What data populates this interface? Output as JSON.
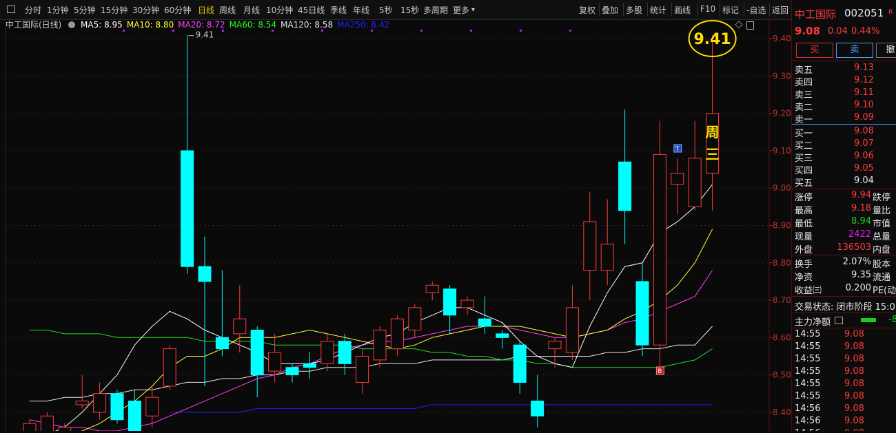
{
  "toolbar": {
    "periods": [
      "分时",
      "1分钟",
      "5分钟",
      "15分钟",
      "30分钟",
      "60分钟",
      "日线",
      "周线",
      "月线",
      "10分钟",
      "45日线",
      "季线",
      "年线",
      "5秒",
      "15秒",
      "多周期",
      "更多"
    ],
    "active_period": "日线",
    "right_items": [
      "复权",
      "叠加",
      "多股",
      "统计",
      "画线",
      "F10",
      "标记",
      "-自选",
      "返回"
    ]
  },
  "chart_header": {
    "name": "中工国际(日线)",
    "ma": [
      {
        "label": "MA5: 8.95",
        "color": "#ffffff"
      },
      {
        "label": "MA10: 8.80",
        "color": "#ffff40"
      },
      {
        "label": "MA20: 8.72",
        "color": "#ff40ff"
      },
      {
        "label": "MA60: 8.54",
        "color": "#20ff20"
      },
      {
        "label": "MA120: 8.58",
        "color": "#e8e8e8"
      },
      {
        "label": "MA250: 8.42",
        "color": "#2020ff"
      }
    ]
  },
  "annotations": {
    "high_label": "9.41",
    "circled_value": "9.41",
    "week_char_1": "周",
    "week_char_2": "三",
    "t_marker": "T",
    "b_marker": "B"
  },
  "y_axis": {
    "min": 8.35,
    "max": 9.45,
    "ticks": [
      "9.40",
      "9.30",
      "9.20",
      "9.10",
      "9.00",
      "8.90",
      "8.80",
      "8.70",
      "8.60",
      "8.50",
      "8.40"
    ]
  },
  "colors": {
    "up": "#ff3b3b",
    "down": "#00ffff",
    "ma5": "#ffffff",
    "ma10": "#ffff40",
    "ma20": "#ff40ff",
    "ma60": "#20dd20",
    "ma120": "#e8e8e8",
    "ma250": "#2020ff",
    "highlight": "#ffe000"
  },
  "chart_data": {
    "type": "candlestick",
    "candles": [
      {
        "o": 8.31,
        "c": 8.37,
        "h": 8.38,
        "l": 8.3
      },
      {
        "o": 8.33,
        "c": 8.39,
        "h": 8.4,
        "l": 8.31
      },
      {
        "o": 8.32,
        "c": 8.36,
        "h": 8.37,
        "l": 8.3
      },
      {
        "o": 8.42,
        "c": 8.43,
        "h": 8.5,
        "l": 8.41
      },
      {
        "o": 8.4,
        "c": 8.45,
        "h": 8.48,
        "l": 8.38
      },
      {
        "o": 8.45,
        "c": 8.38,
        "h": 8.46,
        "l": 8.37
      },
      {
        "o": 8.43,
        "c": 8.34,
        "h": 8.46,
        "l": 8.33
      },
      {
        "o": 8.39,
        "c": 8.44,
        "h": 8.47,
        "l": 8.36
      },
      {
        "o": 8.47,
        "c": 8.57,
        "h": 8.58,
        "l": 8.46
      },
      {
        "o": 9.1,
        "c": 8.79,
        "h": 9.41,
        "l": 8.77
      },
      {
        "o": 8.79,
        "c": 8.75,
        "h": 8.87,
        "l": 8.47
      },
      {
        "o": 8.6,
        "c": 8.57,
        "h": 8.78,
        "l": 8.55
      },
      {
        "o": 8.61,
        "c": 8.65,
        "h": 8.74,
        "l": 8.56
      },
      {
        "o": 8.62,
        "c": 8.5,
        "h": 8.63,
        "l": 8.44
      },
      {
        "o": 8.51,
        "c": 8.56,
        "h": 8.61,
        "l": 8.48
      },
      {
        "o": 8.52,
        "c": 8.5,
        "h": 8.53,
        "l": 8.48
      },
      {
        "o": 8.53,
        "c": 8.52,
        "h": 8.56,
        "l": 8.49
      },
      {
        "o": 8.53,
        "c": 8.59,
        "h": 8.61,
        "l": 8.51
      },
      {
        "o": 8.59,
        "c": 8.53,
        "h": 8.61,
        "l": 8.5
      },
      {
        "o": 8.48,
        "c": 8.55,
        "h": 8.57,
        "l": 8.45
      },
      {
        "o": 8.54,
        "c": 8.62,
        "h": 8.63,
        "l": 8.52
      },
      {
        "o": 8.57,
        "c": 8.65,
        "h": 8.66,
        "l": 8.55
      },
      {
        "o": 8.62,
        "c": 8.68,
        "h": 8.69,
        "l": 8.6
      },
      {
        "o": 8.72,
        "c": 8.74,
        "h": 8.75,
        "l": 8.7
      },
      {
        "o": 8.73,
        "c": 8.66,
        "h": 8.74,
        "l": 8.61
      },
      {
        "o": 8.68,
        "c": 8.7,
        "h": 8.71,
        "l": 8.66
      },
      {
        "o": 8.65,
        "c": 8.63,
        "h": 8.71,
        "l": 8.61
      },
      {
        "o": 8.61,
        "c": 8.6,
        "h": 8.62,
        "l": 8.57
      },
      {
        "o": 8.58,
        "c": 8.48,
        "h": 8.59,
        "l": 8.45
      },
      {
        "o": 8.43,
        "c": 8.39,
        "h": 8.5,
        "l": 8.36
      },
      {
        "o": 8.57,
        "c": 8.59,
        "h": 8.6,
        "l": 8.52
      },
      {
        "o": 8.56,
        "c": 8.68,
        "h": 8.74,
        "l": 8.54
      },
      {
        "o": 8.78,
        "c": 8.91,
        "h": 8.99,
        "l": 8.7
      },
      {
        "o": 8.78,
        "c": 8.85,
        "h": 8.97,
        "l": 8.74
      },
      {
        "o": 9.07,
        "c": 8.94,
        "h": 9.21,
        "l": 8.85
      },
      {
        "o": 8.75,
        "c": 8.58,
        "h": 8.8,
        "l": 8.55
      },
      {
        "o": 8.58,
        "c": 9.09,
        "h": 9.18,
        "l": 8.5
      },
      {
        "o": 9.01,
        "c": 9.04,
        "h": 9.08,
        "l": 8.93
      },
      {
        "o": 8.95,
        "c": 9.08,
        "h": 9.18,
        "l": 8.94
      },
      {
        "o": 9.04,
        "c": 9.2,
        "h": 9.41,
        "l": 8.94
      }
    ],
    "ma5": [
      8.32,
      8.34,
      8.36,
      8.4,
      8.45,
      8.5,
      8.58,
      8.63,
      8.67,
      8.65,
      8.62,
      8.6,
      8.58,
      8.56,
      8.53,
      8.53,
      8.53,
      8.54,
      8.56,
      8.58,
      8.6,
      8.61,
      8.64,
      8.66,
      8.68,
      8.68,
      8.66,
      8.64,
      8.59,
      8.55,
      8.53,
      8.52,
      8.63,
      8.72,
      8.79,
      8.8,
      8.88,
      8.91,
      8.95,
      9.01
    ],
    "ma10": [
      8.3,
      8.32,
      8.33,
      8.35,
      8.37,
      8.4,
      8.43,
      8.47,
      8.52,
      8.55,
      8.55,
      8.57,
      8.6,
      8.6,
      8.6,
      8.61,
      8.62,
      8.61,
      8.6,
      8.59,
      8.58,
      8.57,
      8.58,
      8.6,
      8.61,
      8.62,
      8.63,
      8.63,
      8.63,
      8.62,
      8.61,
      8.6,
      8.61,
      8.62,
      8.65,
      8.67,
      8.7,
      8.74,
      8.8,
      8.89
    ],
    "ma20": [
      8.38,
      8.37,
      8.36,
      8.36,
      8.35,
      8.35,
      8.36,
      8.37,
      8.39,
      8.41,
      8.43,
      8.45,
      8.47,
      8.49,
      8.5,
      8.52,
      8.53,
      8.55,
      8.57,
      8.58,
      8.59,
      8.59,
      8.6,
      8.61,
      8.62,
      8.63,
      8.63,
      8.63,
      8.62,
      8.61,
      8.6,
      8.6,
      8.61,
      8.62,
      8.64,
      8.65,
      8.67,
      8.69,
      8.71,
      8.78
    ],
    "ma60": [
      8.62,
      8.62,
      8.61,
      8.61,
      8.61,
      8.6,
      8.6,
      8.6,
      8.6,
      8.6,
      8.59,
      8.59,
      8.59,
      8.59,
      8.58,
      8.58,
      8.58,
      8.58,
      8.58,
      8.57,
      8.57,
      8.57,
      8.57,
      8.56,
      8.56,
      8.55,
      8.55,
      8.54,
      8.54,
      8.53,
      8.53,
      8.52,
      8.52,
      8.52,
      8.52,
      8.52,
      8.52,
      8.53,
      8.54,
      8.57
    ],
    "ma120": [
      8.43,
      8.43,
      8.44,
      8.44,
      8.45,
      8.45,
      8.46,
      8.46,
      8.47,
      8.48,
      8.48,
      8.49,
      8.49,
      8.5,
      8.5,
      8.51,
      8.51,
      8.52,
      8.52,
      8.52,
      8.53,
      8.53,
      8.53,
      8.54,
      8.54,
      8.54,
      8.54,
      8.54,
      8.55,
      8.55,
      8.55,
      8.55,
      8.55,
      8.56,
      8.56,
      8.57,
      8.57,
      8.58,
      8.58,
      8.63
    ],
    "ma250": [
      null,
      null,
      null,
      null,
      null,
      null,
      null,
      null,
      8.4,
      8.4,
      8.4,
      8.4,
      8.4,
      8.41,
      8.41,
      8.41,
      8.41,
      8.41,
      8.41,
      8.41,
      8.41,
      8.41,
      8.41,
      8.42,
      8.42,
      8.42,
      8.42,
      8.42,
      8.42,
      8.42,
      8.42,
      8.42,
      8.42,
      8.42,
      8.42,
      8.42,
      8.42,
      8.42,
      8.42,
      8.42
    ]
  },
  "quote": {
    "name": "中工国际",
    "code": "002051",
    "badge": "R",
    "price": "9.08",
    "change": "0.04",
    "change_pct": "0.44%",
    "buy_label": "买",
    "sell_label": "卖",
    "cancel_label": "撤",
    "asks": [
      {
        "label": "卖五",
        "price": "9.13"
      },
      {
        "label": "卖四",
        "price": "9.12"
      },
      {
        "label": "卖三",
        "price": "9.11"
      },
      {
        "label": "卖二",
        "price": "9.10"
      },
      {
        "label": "卖一",
        "price": "9.09"
      }
    ],
    "bids": [
      {
        "label": "买一",
        "price": "9.08"
      },
      {
        "label": "买二",
        "price": "9.07"
      },
      {
        "label": "买三",
        "price": "9.06"
      },
      {
        "label": "买四",
        "price": "9.05"
      },
      {
        "label": "买五",
        "price": "9.04"
      }
    ],
    "stats": [
      {
        "label": "涨停",
        "value": "9.94",
        "label2": "跌停",
        "color": "red"
      },
      {
        "label": "最高",
        "value": "9.18",
        "label2": "量比",
        "color": "red"
      },
      {
        "label": "最低",
        "value": "8.94",
        "label2": "市值",
        "color": "green"
      },
      {
        "label": "现量",
        "value": "2422",
        "label2": "总量",
        "color": "mag"
      },
      {
        "label": "外盘",
        "value": "136503",
        "label2": "内盘",
        "color": "red"
      }
    ],
    "stats2": [
      {
        "label": "换手",
        "value": "2.07%",
        "label2": "股本"
      },
      {
        "label": "净资",
        "value": "9.35",
        "label2": "流通"
      },
      {
        "label": "收益㈢",
        "value": "0.200",
        "label2": "PE(动"
      }
    ],
    "trade_status": "交易状态: 闭市阶段 15:0",
    "main_flow_label": "主力净额",
    "main_flow_value": "-8",
    "ticks": [
      {
        "time": "14:55",
        "price": "9.08"
      },
      {
        "time": "14:55",
        "price": "9.08"
      },
      {
        "time": "14:55",
        "price": "9.08"
      },
      {
        "time": "14:55",
        "price": "9.08"
      },
      {
        "time": "14:55",
        "price": "9.08"
      },
      {
        "time": "14:55",
        "price": "9.08"
      },
      {
        "time": "14:56",
        "price": "9.08"
      },
      {
        "time": "14:56",
        "price": "9.08"
      },
      {
        "time": "14:56",
        "price": "9.08"
      }
    ]
  }
}
